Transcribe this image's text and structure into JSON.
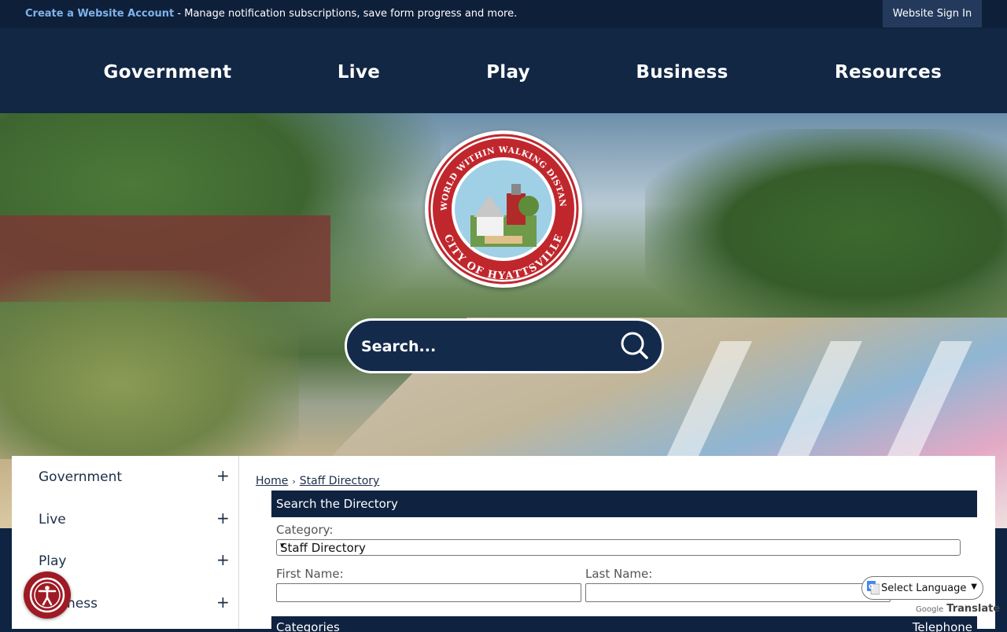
{
  "topbar": {
    "create_account": "Create a Website Account",
    "message": " - Manage notification subscriptions, save form progress and more.",
    "sign_in": "Website Sign In"
  },
  "nav": {
    "items": [
      "Government",
      "Live",
      "Play",
      "Business",
      "Resources"
    ]
  },
  "seal": {
    "text_top": "A WORLD WITHIN WALKING DISTANCE",
    "text_bottom": "CITY OF HYATTSVILLE"
  },
  "search": {
    "placeholder": "Search..."
  },
  "sidebar": {
    "items": [
      {
        "label": "Government",
        "toggle": "+"
      },
      {
        "label": "Live",
        "toggle": "+"
      },
      {
        "label": "Play",
        "toggle": "+"
      },
      {
        "label": "Business",
        "toggle": "+"
      }
    ]
  },
  "breadcrumb": {
    "home": "Home",
    "separator": "›",
    "current": "Staff Directory"
  },
  "directory": {
    "heading": "Search the Directory",
    "category_label": "Category:",
    "category_value": "Staff Directory",
    "first_name_label": "First Name:",
    "last_name_label": "Last Name:",
    "table_headers": [
      "Categories",
      "Telephone"
    ]
  },
  "translate": {
    "select_label": "Select Language",
    "powered_by": "Google",
    "translate_label": "Translate"
  },
  "colors": {
    "navy": "#112744",
    "accent_link": "#7fb3e8",
    "seal_red": "#c0272d",
    "accessibility": "#9e1b25"
  }
}
